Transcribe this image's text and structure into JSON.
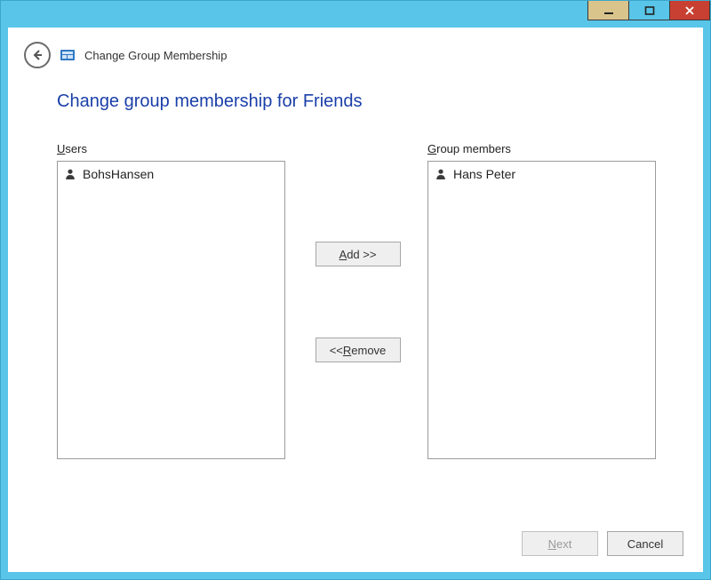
{
  "window": {
    "breadcrumb": "Change Group Membership"
  },
  "page": {
    "title": "Change group membership for Friends"
  },
  "labels": {
    "users_pre": "U",
    "users_post": "sers",
    "group_pre": "G",
    "group_post": "roup members",
    "add_pre": "A",
    "add_post": "dd >>",
    "remove_pre": "<< ",
    "remove_ul": "R",
    "remove_post": "emove",
    "next_pre": "N",
    "next_post": "ext",
    "cancel": "Cancel"
  },
  "lists": {
    "users": [
      {
        "name": "BohsHansen"
      }
    ],
    "members": [
      {
        "name": "Hans Peter"
      }
    ]
  }
}
